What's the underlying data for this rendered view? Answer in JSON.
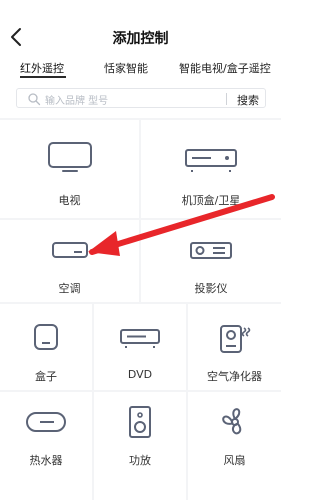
{
  "header": {
    "title": "添加控制"
  },
  "tabs": [
    {
      "label": "红外遥控"
    },
    {
      "label": "恬家智能"
    },
    {
      "label": "智能电视/盒子遥控"
    }
  ],
  "search": {
    "placeholder": "输入品牌 型号",
    "button": "搜索"
  },
  "devices": [
    {
      "label": "电视",
      "icon": "tv-icon"
    },
    {
      "label": "机顶盒/卫星",
      "icon": "set-top-box-icon"
    },
    {
      "label": "空调",
      "icon": "air-conditioner-icon"
    },
    {
      "label": "投影仪",
      "icon": "projector-icon"
    },
    {
      "label": "盒子",
      "icon": "box-icon"
    },
    {
      "label": "DVD",
      "icon": "dvd-icon"
    },
    {
      "label": "空气净化器",
      "icon": "air-purifier-icon"
    },
    {
      "label": "热水器",
      "icon": "water-heater-icon"
    },
    {
      "label": "功放",
      "icon": "amplifier-icon"
    },
    {
      "label": "风扇",
      "icon": "fan-icon"
    }
  ],
  "colors": {
    "icon_stroke": "#5b6376",
    "arrow": "#e8262a",
    "grid_gap": "#f3f4f6"
  }
}
